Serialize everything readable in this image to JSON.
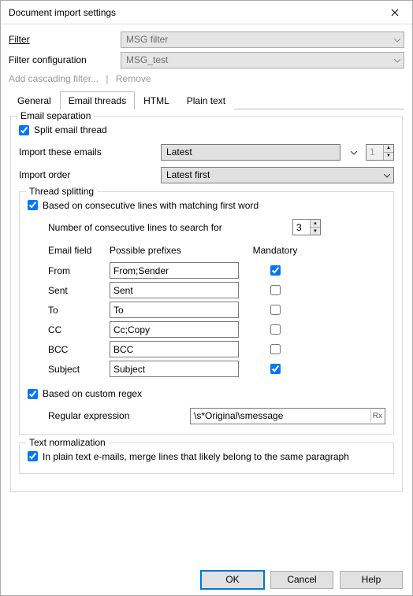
{
  "title": "Document import settings",
  "filterRow": {
    "label": "Filter",
    "value": "MSG filter"
  },
  "filterConfigRow": {
    "label": "Filter configuration",
    "value": "MSG_test"
  },
  "linkRow": {
    "addCascading": "Add cascading filter...",
    "remove": "Remove"
  },
  "tabs": {
    "general": "General",
    "emailThreads": "Email threads",
    "html": "HTML",
    "plainText": "Plain text"
  },
  "emailSeparation": {
    "legend": "Email separation",
    "splitLabel": "Split email thread",
    "splitChecked": true,
    "importTheseLabel": "Import these emails",
    "importTheseValue": "Latest",
    "importCount": "1",
    "importOrderLabel": "Import order",
    "importOrderValue": "Latest first"
  },
  "threadSplitting": {
    "legend": "Thread splitting",
    "basedConsecutiveLabel": "Based on consecutive lines with matching first word",
    "basedConsecutiveChecked": true,
    "numLinesLabel": "Number of consecutive lines to search for",
    "numLinesValue": "3",
    "headers": {
      "field": "Email field",
      "prefixes": "Possible prefixes",
      "mandatory": "Mandatory"
    },
    "rows": [
      {
        "field": "From",
        "prefix": "From;Sender",
        "mandatory": true
      },
      {
        "field": "Sent",
        "prefix": "Sent",
        "mandatory": false
      },
      {
        "field": "To",
        "prefix": "To",
        "mandatory": false
      },
      {
        "field": "CC",
        "prefix": "Cc;Copy",
        "mandatory": false
      },
      {
        "field": "BCC",
        "prefix": "BCC",
        "mandatory": false
      },
      {
        "field": "Subject",
        "prefix": "Subject",
        "mandatory": true
      }
    ],
    "basedRegexLabel": "Based on custom regex",
    "basedRegexChecked": true,
    "regexLabel": "Regular expression",
    "regexValue": "\\s*Original\\smessage",
    "rxButton": "Rx"
  },
  "textNorm": {
    "legend": "Text normalization",
    "mergeLabel": "In plain text e-mails, merge lines that likely belong to the same paragraph",
    "mergeChecked": true
  },
  "buttons": {
    "ok": "OK",
    "cancel": "Cancel",
    "help": "Help"
  }
}
